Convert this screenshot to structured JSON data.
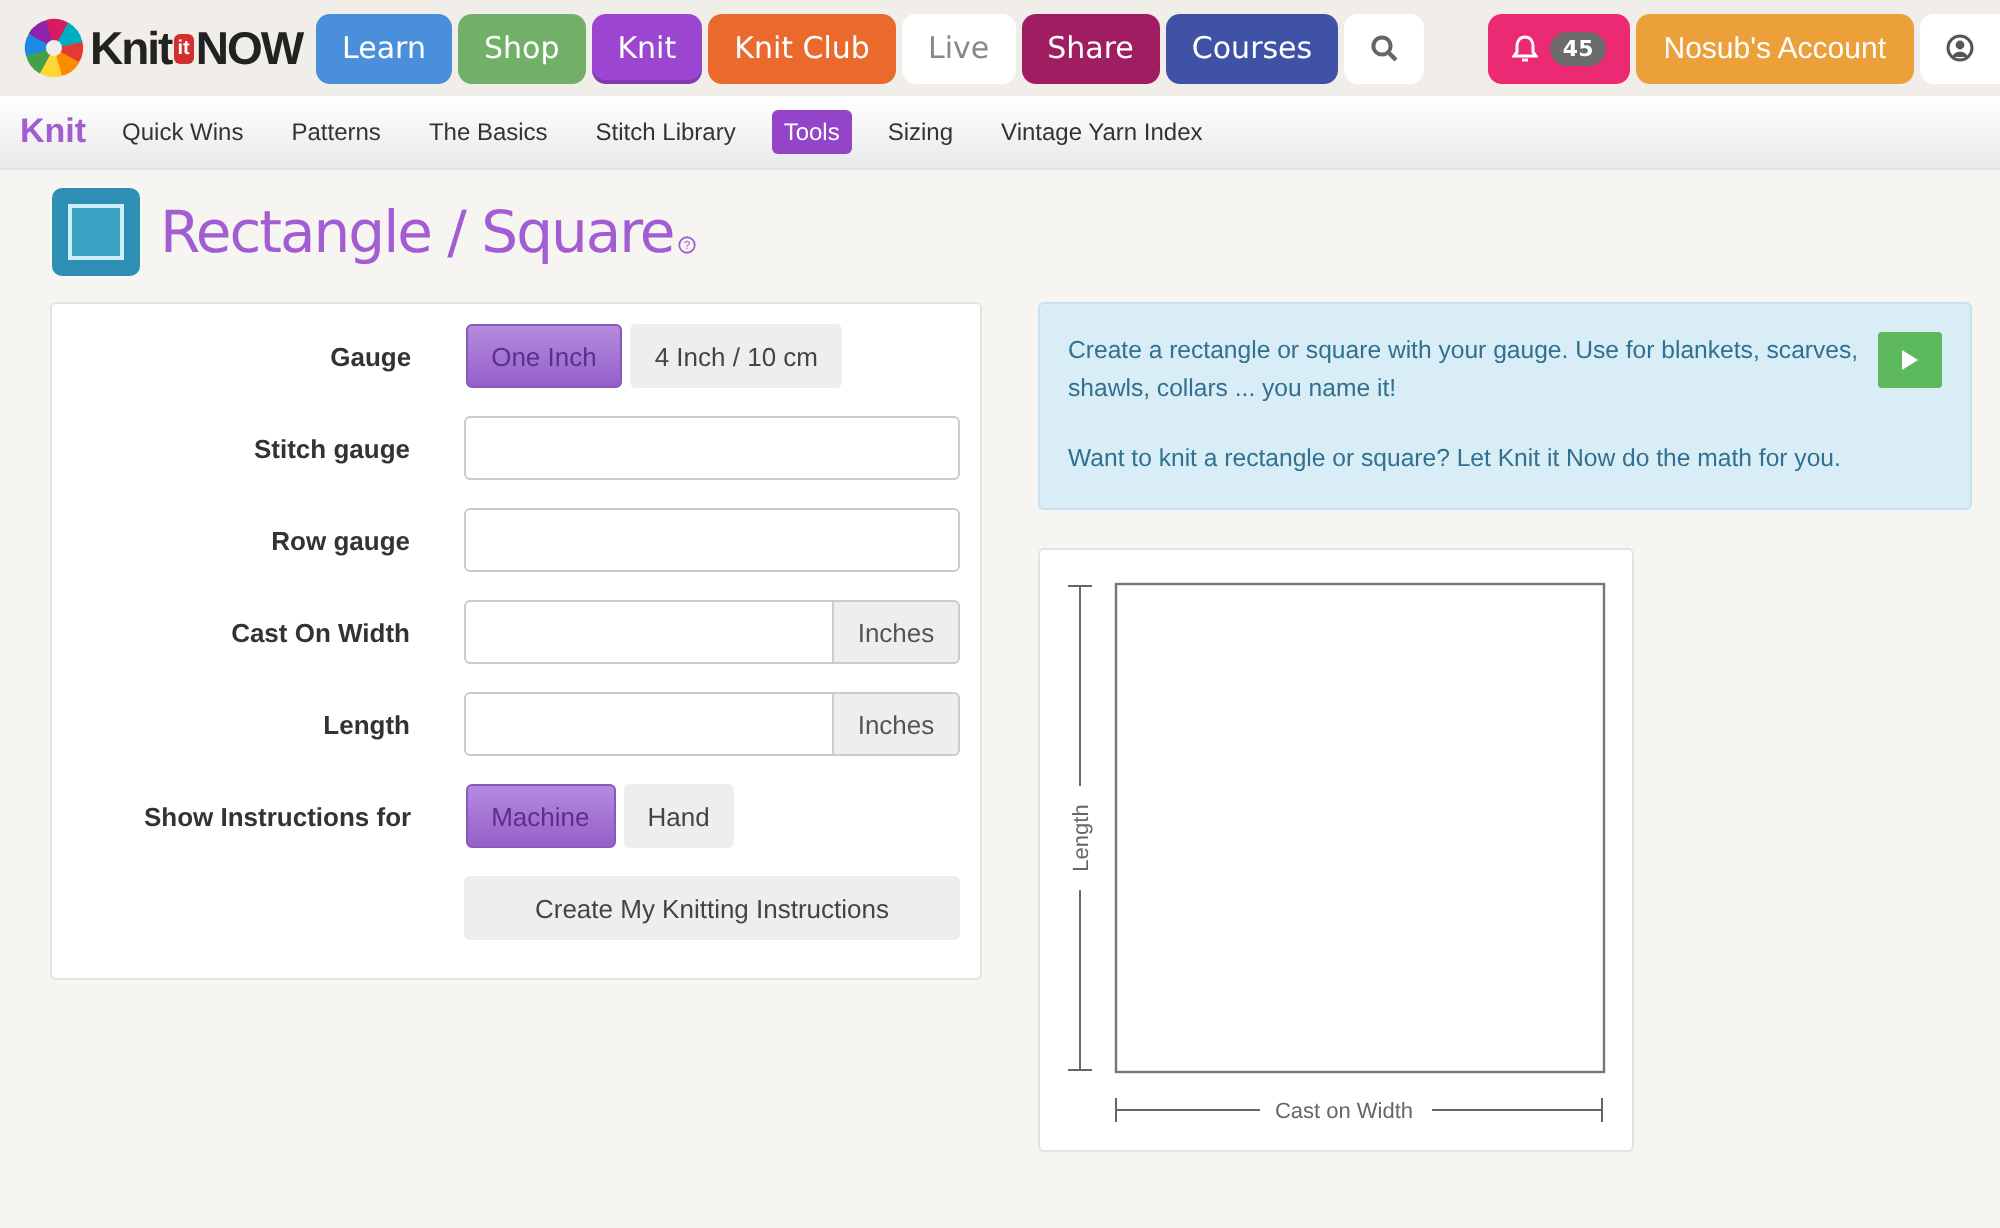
{
  "logo": {
    "parts": [
      "Knit",
      "it",
      "NOW"
    ]
  },
  "top_nav": [
    {
      "label": "Learn",
      "color": "#4a8fdc",
      "selected": false
    },
    {
      "label": "Shop",
      "color": "#72b06a",
      "selected": false
    },
    {
      "label": "Knit",
      "color": "#9b45d0",
      "selected": true
    },
    {
      "label": "Knit Club",
      "color": "#ea6a2e",
      "selected": false
    },
    {
      "label": "Live",
      "color": "#ffffff",
      "selected": false
    },
    {
      "label": "Share",
      "color": "#a01d62",
      "selected": false
    },
    {
      "label": "Courses",
      "color": "#3f52a6",
      "selected": false
    }
  ],
  "notifications": {
    "count": "45"
  },
  "account": {
    "label": "Nosub's Account"
  },
  "sub_nav": {
    "title": "Knit",
    "items": [
      {
        "label": "Quick Wins",
        "selected": false
      },
      {
        "label": "Patterns",
        "selected": false
      },
      {
        "label": "The Basics",
        "selected": false
      },
      {
        "label": "Stitch Library",
        "selected": false
      },
      {
        "label": "Tools",
        "selected": true
      },
      {
        "label": "Sizing",
        "selected": false
      },
      {
        "label": "Vintage Yarn Index",
        "selected": false
      }
    ]
  },
  "page_title": "Rectangle / Square",
  "title_help": "?",
  "form": [
    {
      "kind": "toggle",
      "label": "Gauge",
      "options": [
        {
          "label": "One Inch",
          "selected": true
        },
        {
          "label": "4 Inch / 10 cm",
          "selected": false
        }
      ]
    },
    {
      "kind": "input",
      "label": "Stitch gauge"
    },
    {
      "kind": "input",
      "label": "Row gauge"
    },
    {
      "kind": "unit",
      "label": "Cast On Width",
      "unit": "Inches"
    },
    {
      "kind": "unit",
      "label": "Length",
      "unit": "Inches"
    },
    {
      "kind": "toggle",
      "label": "Show Instructions for",
      "options": [
        {
          "label": "Machine",
          "selected": true
        },
        {
          "label": "Hand",
          "selected": false
        }
      ]
    },
    {
      "kind": "button",
      "label": "Create My Knitting Instructions"
    }
  ],
  "info": {
    "paragraphs": [
      "Create a rectangle or square with your gauge. Use for blankets, scarves, shawls, collars ... you name it!",
      "Want to knit a rectangle or square? Let Knit it Now do the math for you."
    ]
  },
  "diagram": {
    "length_label": "Length",
    "width_label": "Cast on Width"
  }
}
